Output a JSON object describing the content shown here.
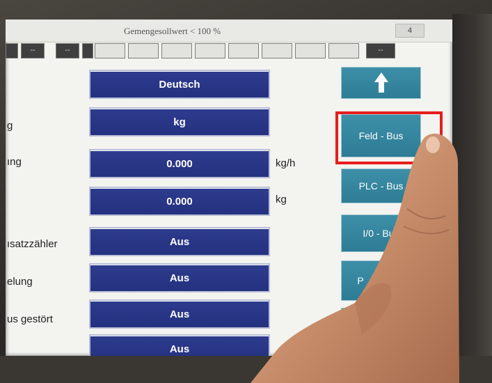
{
  "status_bar": {
    "title": "Gemengesollwert < 100 %",
    "number": "4"
  },
  "indicators": [
    "--",
    "--",
    "--",
    "--"
  ],
  "rows": [
    {
      "label": "",
      "value": "Deutsch",
      "unit": ""
    },
    {
      "label": "g",
      "value": "kg",
      "unit": ""
    },
    {
      "label": "ıng",
      "value": "0.000",
      "unit": "kg/h"
    },
    {
      "label": "",
      "value": "0.000",
      "unit": "kg"
    },
    {
      "label": "ısatzzähler",
      "value": "Aus",
      "unit": ""
    },
    {
      "label": "elung",
      "value": "Aus",
      "unit": ""
    },
    {
      "label": "us gestört",
      "value": "Aus",
      "unit": ""
    },
    {
      "label": "",
      "value": "Aus",
      "unit": ""
    }
  ],
  "side_buttons": {
    "up_icon": "arrow-up-icon",
    "feld_bus": "Feld - Bus",
    "plc_bus": "PLC - Bus",
    "io_bus": "I/0 - Bus",
    "partial": "P       ierter"
  },
  "colors": {
    "value_button": "#2a378a",
    "side_button": "#3586a0",
    "highlight": "#e81c1c"
  }
}
